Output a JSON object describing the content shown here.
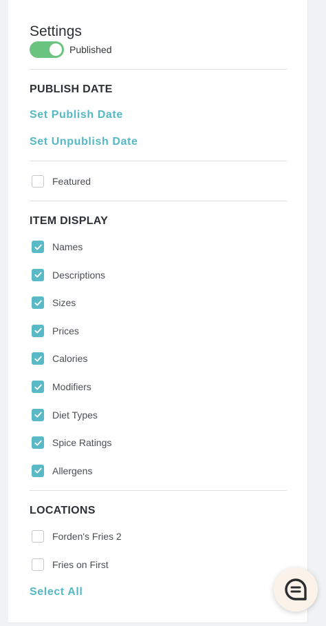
{
  "settings": {
    "title": "Settings",
    "published_label": "Published",
    "published": true
  },
  "publish_date": {
    "heading": "PUBLISH DATE",
    "set_publish": "Set Publish Date",
    "set_unpublish": "Set Unpublish Date"
  },
  "featured": {
    "label": "Featured",
    "checked": false
  },
  "item_display": {
    "heading": "ITEM DISPLAY",
    "items": [
      {
        "label": "Names",
        "checked": true
      },
      {
        "label": "Descriptions",
        "checked": true
      },
      {
        "label": "Sizes",
        "checked": true
      },
      {
        "label": "Prices",
        "checked": true
      },
      {
        "label": "Calories",
        "checked": true
      },
      {
        "label": "Modifiers",
        "checked": true
      },
      {
        "label": "Diet Types",
        "checked": true
      },
      {
        "label": "Spice Ratings",
        "checked": true
      },
      {
        "label": "Allergens",
        "checked": true
      }
    ]
  },
  "locations": {
    "heading": "LOCATIONS",
    "items": [
      {
        "label": "Forden's Fries 2",
        "checked": false
      },
      {
        "label": "Fries on First",
        "checked": false
      }
    ],
    "select_all": "Select All"
  },
  "colors": {
    "accent": "#55b8c3",
    "toggle_on": "#6ac480",
    "checkbox_checked": "#59b9c6"
  },
  "chat": {
    "icon": "chat-bubble-icon"
  }
}
